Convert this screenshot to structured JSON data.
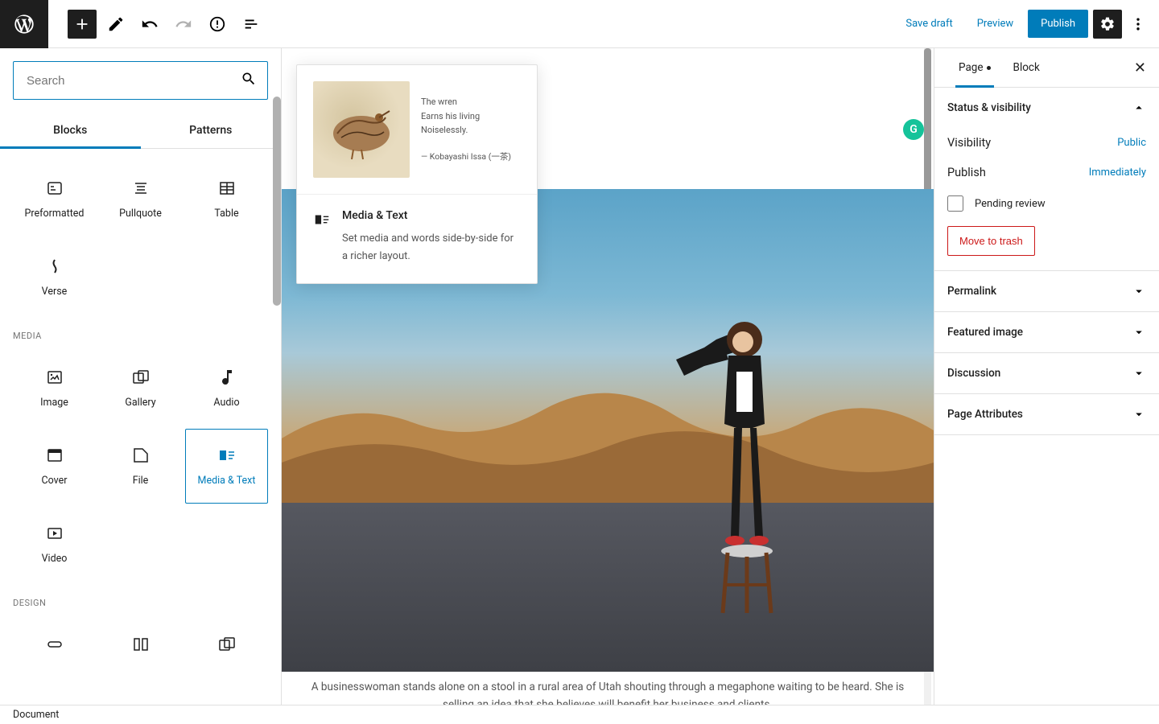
{
  "toolbar": {
    "save_draft": "Save draft",
    "preview": "Preview",
    "publish": "Publish"
  },
  "inserter": {
    "search_placeholder": "Search",
    "tabs": {
      "blocks": "Blocks",
      "patterns": "Patterns"
    },
    "text_blocks": {
      "preformatted": "Preformatted",
      "pullquote": "Pullquote",
      "table": "Table",
      "verse": "Verse"
    },
    "media_label": "MEDIA",
    "media_blocks": {
      "image": "Image",
      "gallery": "Gallery",
      "audio": "Audio",
      "cover": "Cover",
      "file": "File",
      "media_text": "Media & Text",
      "video": "Video"
    },
    "design_label": "DESIGN"
  },
  "preview_popover": {
    "poem_l1": "The wren",
    "poem_l2": "Earns his living",
    "poem_l3": "Noiselessly.",
    "poem_credit": "— Kobayashi Issa (一茶)",
    "title": "Media & Text",
    "description": "Set media and words side-by-side for a richer layout."
  },
  "canvas": {
    "caption": "A businesswoman stands alone on a stool in a rural area of Utah shouting through a megaphone waiting to be heard. She is selling an idea that she believes will benefit her business and clients."
  },
  "sidebar": {
    "tabs": {
      "page": "Page",
      "block": "Block"
    },
    "status_title": "Status & visibility",
    "visibility_label": "Visibility",
    "visibility_value": "Public",
    "publish_label": "Publish",
    "publish_value": "Immediately",
    "pending_review": "Pending review",
    "move_to_trash": "Move to trash",
    "permalink": "Permalink",
    "featured_image": "Featured image",
    "discussion": "Discussion",
    "page_attributes": "Page Attributes"
  },
  "footer": {
    "breadcrumb": "Document"
  }
}
